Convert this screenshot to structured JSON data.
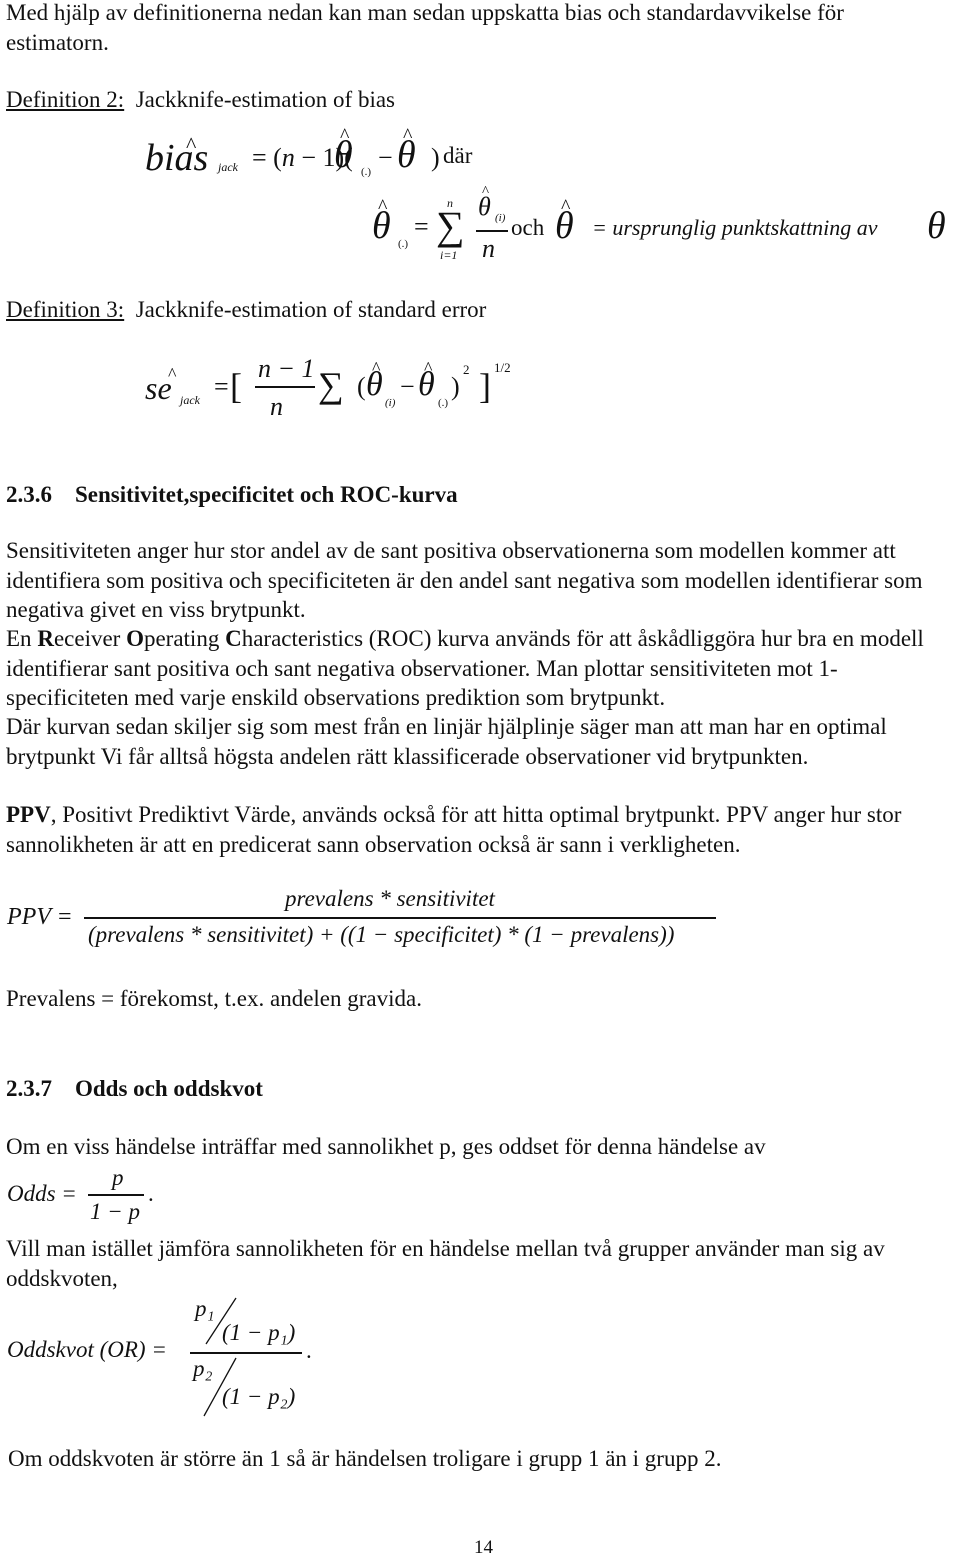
{
  "intro": {
    "line1": "Med hjälp av definitionerna nedan kan man sedan uppskatta bias och standardavvikelse för",
    "line2": "estimatorn."
  },
  "definition2": {
    "label": "Definition 2:",
    "title": "Jackknife-estimation of bias",
    "formula": {
      "lhs_base": "bias",
      "lhs_sub": "jack",
      "rhs": "= (n − 1)(θ̂(.) − θ̂ )",
      "where": "där",
      "mean_lhs": "θ̂(.)",
      "sum_upper": "n",
      "sum_lower": "i=1",
      "numerator": "θ̂(i)",
      "denominator": "n",
      "och": "och",
      "theta_hat_def": "= ursprunglig punktskattning av",
      "theta": "θ"
    }
  },
  "definition3": {
    "label": "Definition 3:",
    "title": "Jackknife-estimation of standard error",
    "formula": {
      "lhs_base": "se",
      "lhs_sub": "jack",
      "frac_num": "n − 1",
      "frac_den": "n",
      "body": "(θ̂(i) − θ̂(.))",
      "square": "2",
      "power": "1/2"
    }
  },
  "section236": {
    "number": "2.3.6",
    "title": "Sensitivitet,specificitet och ROC-kurva",
    "paragraphs": [
      "Sensitiviteten anger hur stor andel av de sant positiva observationerna som modellen kommer att identifiera som positiva och specificiteten är den andel sant negativa som modellen identifierar som negativa givet en viss brytpunkt.",
      "Man plottar sensitiviteten mot 1-specificiteten med varje enskild observations prediktion som brytpunkt.",
      "Där kurvan sedan skiljer sig som mest från en linjär hjälplinje säger man att man har en optimal brytpunkt Vi får alltså högsta andelen rätt klassificerade observationer vid brytpunkten.",
      ", Positivt Prediktivt Värde, används också för att hitta optimal brytpunkt. PPV anger hur stor sannolikheten är att en predicerat sann observation också är sann i verkligheten."
    ],
    "roc_parts": [
      "En ",
      "R",
      "eceiver ",
      "O",
      "perating ",
      "C",
      "haracteristics (ROC) kurva används för att åskådliggöra hur bra en modell identifierar sant positiva och sant negativa observationer. "
    ],
    "ppv_bold": "PPV",
    "ppv_formula": {
      "lhs": "PPV =",
      "numerator": "prevalens * sensitivitet",
      "denominator": "(prevalens * sensitivitet) + ((1 − specificitet) * (1 − prevalens))"
    },
    "prevalens_note": "Prevalens = förekomst, t.ex. andelen gravida."
  },
  "section237": {
    "number": "2.3.7",
    "title": "Odds och oddskvot",
    "intro": "Om en viss händelse inträffar med sannolikhet p, ges oddset för denna händelse av",
    "odds_formula": {
      "lhs": "Odds =",
      "numerator": "p",
      "denominator": "1 − p",
      "end": "."
    },
    "para2": "Vill man istället jämföra sannolikheten för en händelse mellan två grupper använder man sig av oddskvoten,",
    "or_formula": {
      "lhs": "Oddskvot (OR) =",
      "num_top": "p₁",
      "num_bottom": "(1 − p₁)",
      "den_top": "p₂",
      "den_bottom": "(1 − p₂)",
      "end": "."
    },
    "conclusion": "Om oddskvoten är större än 1 så är händelsen troligare i grupp 1 än i grupp 2."
  },
  "page_number": "14"
}
